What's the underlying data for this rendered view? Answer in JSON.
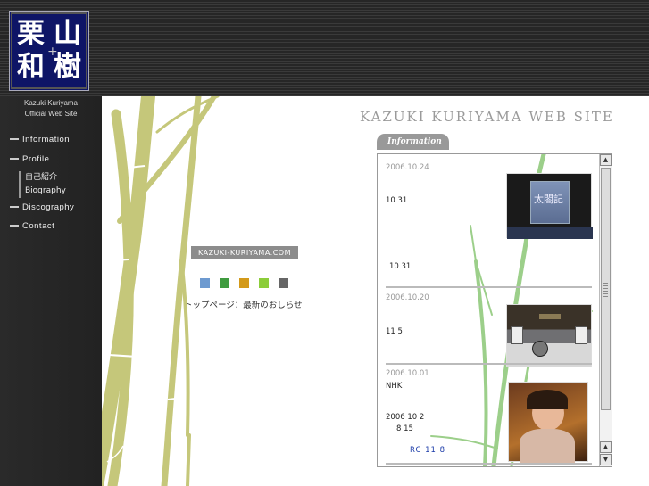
{
  "logo": {
    "c1": "栗",
    "c2": "山",
    "c3": "和",
    "c4": "樹",
    "plus": "+"
  },
  "owner": {
    "line1": "Kazuki Kuriyama",
    "line2": "Official Web Site"
  },
  "nav": {
    "information": "Information",
    "profile": "Profile",
    "profile_sub": [
      "自己紹介",
      "Biography"
    ],
    "discography": "Discography",
    "contact": "Contact"
  },
  "site_title": "KAZUKI KURIYAMA WEB SITE",
  "center": {
    "logo_text": "KAZUKI-KURIYAMA.COM",
    "dot_colors": [
      "#6d9ad0",
      "#3f9b3f",
      "#d39a1a",
      "#8ccd3a",
      "#666666"
    ],
    "page_label": "トップページ：最新のおしらせ"
  },
  "info_tab": "Information",
  "news": [
    {
      "date": "2006.10.24",
      "lines": [
        "10 31",
        "10 31"
      ]
    },
    {
      "date": "2006.10.20",
      "lines": [
        "11 5"
      ]
    },
    {
      "date": "2006.10.01",
      "lines": [
        "NHK",
        "2006 10 2",
        "8 15"
      ],
      "link": "RC 11 8"
    }
  ],
  "photo_texts": {
    "sign": "太閤記"
  },
  "colors": {
    "bamboo": "#c5c77a",
    "bamboo_green": "#9ccf8a",
    "accent_blue": "#0e1566"
  }
}
